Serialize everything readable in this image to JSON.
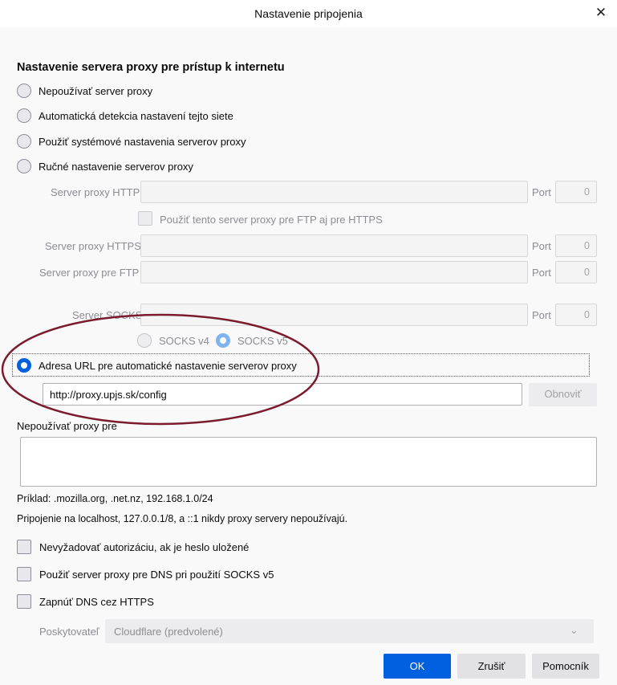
{
  "window": {
    "title": "Nastavenie pripojenia",
    "close_glyph": "✕"
  },
  "section_title": "Nastavenie servera proxy pre prístup k internetu",
  "proxy_modes": [
    {
      "label": "Nepoužívať server proxy",
      "selected": false
    },
    {
      "label": "Automatická detekcia nastavení tejto siete",
      "selected": false
    },
    {
      "label": "Použiť systémové nastavenia serverov proxy",
      "selected": false
    },
    {
      "label": "Ručné nastavenie serverov proxy",
      "selected": false
    },
    {
      "label": "Adresa URL pre automatické nastavenie serverov proxy",
      "selected": true
    }
  ],
  "manual": {
    "http_label": "Server proxy HTTP",
    "https_label": "Server proxy HTTPS",
    "ftp_label": "Server proxy pre FTP",
    "socks_label": "Server SOCKS",
    "port_label": "Port",
    "http_port": "0",
    "https_port": "0",
    "ftp_port": "0",
    "socks_port": "0",
    "share_checkbox_label": "Použiť tento server proxy pre FTP aj pre HTTPS",
    "socks_v4_label": "SOCKS v4",
    "socks_v5_label": "SOCKS v5",
    "socks_version_selected": "SOCKS v5"
  },
  "autoconfig": {
    "url": "http://proxy.upjs.sk/config",
    "reload_label": "Obnoviť"
  },
  "no_proxy": {
    "label": "Nepoužívať proxy pre",
    "value": "",
    "example": "Príklad: .mozilla.org, .net.nz, 192.168.1.0/24",
    "localhost_note": "Pripojenie na localhost, 127.0.0.1/8, a ::1 nikdy proxy servery nepoužívajú."
  },
  "options": [
    {
      "label": "Nevyžadovať autorizáciu, ak je heslo uložené",
      "checked": false
    },
    {
      "label": "Použiť server proxy pre DNS pri použití SOCKS v5",
      "checked": false
    },
    {
      "label": "Zapnúť DNS cez HTTPS",
      "checked": false
    }
  ],
  "doh": {
    "provider_label": "Poskytovateľ",
    "provider_value": "Cloudflare (predvolené)"
  },
  "buttons": {
    "ok": "OK",
    "cancel": "Zrušiť",
    "help": "Pomocník"
  },
  "colors": {
    "accent": "#0060df",
    "annotation_ellipse": "#7a1b2e"
  }
}
